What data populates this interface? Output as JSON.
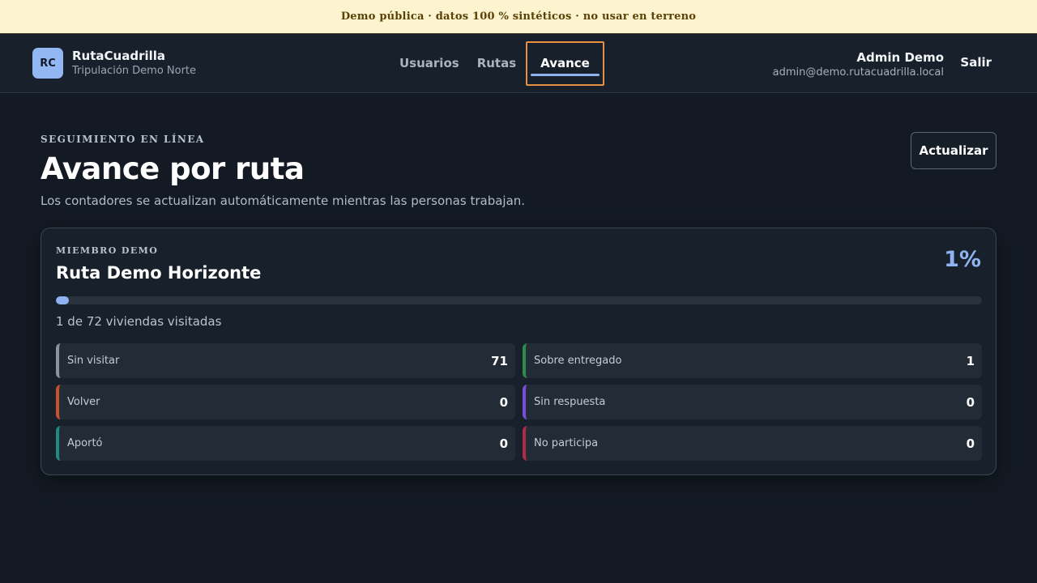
{
  "banner": {
    "text": "Demo pública · datos 100 % sintéticos · no usar en terreno"
  },
  "header": {
    "brand_badge": "RC",
    "brand_name": "RutaCuadrilla",
    "brand_sub": "Tripulación Demo Norte",
    "nav": [
      {
        "label": "Usuarios",
        "active": false
      },
      {
        "label": "Rutas",
        "active": false
      },
      {
        "label": "Avance",
        "active": true
      }
    ],
    "user_name": "Admin Demo",
    "user_email": "admin@demo.rutacuadrilla.local",
    "logout_label": "Salir"
  },
  "page": {
    "kicker": "SEGUIMIENTO EN LÍNEA",
    "title": "Avance por ruta",
    "subtitle": "Los contadores se actualizan automáticamente mientras las personas trabajan.",
    "refresh_label": "Actualizar"
  },
  "route_card": {
    "kicker": "MIEMBRO DEMO",
    "title": "Ruta Demo Horizonte",
    "percent_label": "1%",
    "progress_fraction": 0.0139,
    "progress_text": "1 de 72 viviendas visitadas",
    "stats": [
      {
        "label": "Sin visitar",
        "value": "71",
        "color": "#8b949e"
      },
      {
        "label": "Sobre entregado",
        "value": "1",
        "color": "#2e8b4e"
      },
      {
        "label": "Volver",
        "value": "0",
        "color": "#c8502a"
      },
      {
        "label": "Sin respuesta",
        "value": "0",
        "color": "#7c4ddb"
      },
      {
        "label": "Aportó",
        "value": "0",
        "color": "#1f8a80"
      },
      {
        "label": "No participa",
        "value": "0",
        "color": "#b02a4a"
      }
    ]
  }
}
